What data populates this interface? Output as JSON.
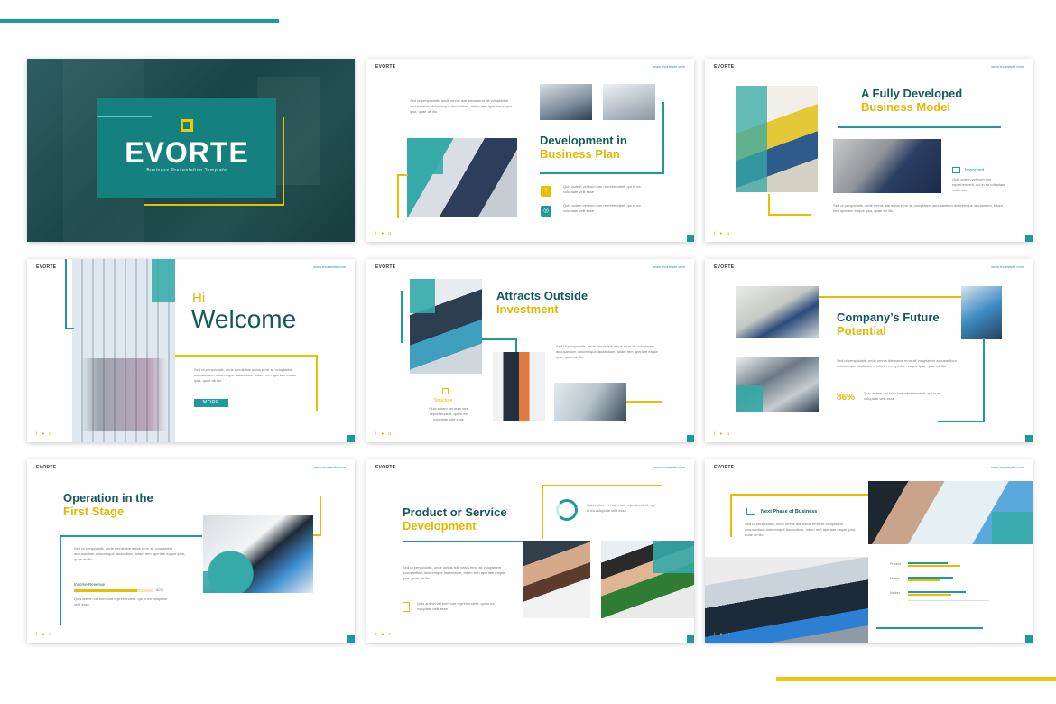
{
  "brand": {
    "logo": "EVORTE",
    "url": "www.evortesite.com",
    "social": "f ♥ ◘"
  },
  "colors": {
    "teal": "#1e9a9b",
    "dark_teal": "#14595a",
    "yellow": "#e7bf00"
  },
  "lorem": {
    "short": "Sed ut perspiciatis, unde omnis iste natus error sit voluptatem accusantium doloremque laudantium, totam rem aperiam eaque ipsa, quae ab illo.",
    "tiny": "Quis autem vel eum iure reprehenderit, qui in ea voluptate velit esse"
  },
  "slides": {
    "cover": {
      "title": "EVORTE",
      "subtitle": "Business Presentation Template"
    },
    "s2": {
      "title_1": "Development in",
      "title_2": "Business Plan"
    },
    "s3": {
      "title_1": "A Fully Developed",
      "title_2": "Business Model",
      "label": "Important"
    },
    "s4": {
      "hi": "Hi",
      "welcome": "Welcome",
      "button": "MORE"
    },
    "s5": {
      "title_1": "Attracts Outside",
      "title_2": "Investment",
      "label": "Structure"
    },
    "s6": {
      "title_1": "Company’s Future",
      "title_2": "Potential",
      "percent": "86%"
    },
    "s7": {
      "title_1": "Operation in the",
      "title_2": "First Stage",
      "bar_label": "Income Revenue",
      "bar_value": "80%"
    },
    "s8": {
      "title_1": "Product or Service",
      "title_2": "Development"
    },
    "s9": {
      "title_1": "Next Phase of Business",
      "bars": [
        {
          "label": "Product",
          "value": 0.7
        },
        {
          "label": "Market",
          "value": 0.8
        },
        {
          "label": "Market",
          "value": 0.9
        }
      ]
    }
  }
}
